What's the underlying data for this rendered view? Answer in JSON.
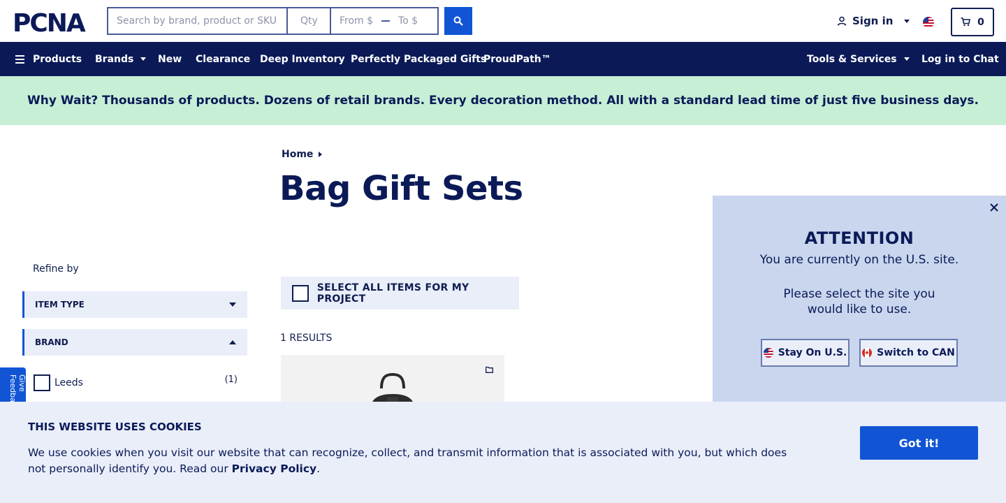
{
  "header": {
    "logo_text": "PCNA",
    "search_placeholder": "Search by brand, product or SKU",
    "qty_placeholder": "Qty",
    "price_from_placeholder": "From $",
    "price_to_placeholder": "To $",
    "signin_label": "Sign in",
    "cart_count": "0"
  },
  "nav": {
    "items": [
      {
        "label": "Products"
      },
      {
        "label": "Brands"
      },
      {
        "label": "New"
      },
      {
        "label": "Clearance"
      },
      {
        "label": "Deep Inventory"
      },
      {
        "label": "Perfectly Packaged Gifts"
      },
      {
        "label": "ProudPath™"
      }
    ],
    "tools_label": "Tools & Services",
    "chat_label": "Log in to Chat"
  },
  "promo": {
    "text": "Why Wait? Thousands of products. Dozens of retail brands. Every decoration method. All with a standard lead time of just five business days."
  },
  "breadcrumb": {
    "home": "Home"
  },
  "page": {
    "title": "Bag Gift Sets"
  },
  "refine": {
    "label": "Refine by",
    "facets": [
      {
        "label": "ITEM TYPE",
        "state": "collapsed"
      },
      {
        "label": "BRAND",
        "state": "expanded"
      }
    ],
    "brand_options": [
      {
        "label": "Leeds",
        "count": "(1)"
      }
    ]
  },
  "feedback": {
    "label": "Give Feedback"
  },
  "results": {
    "select_all_label": "SELECT ALL ITEMS FOR MY PROJECT",
    "count_label": "1 RESULTS"
  },
  "attention": {
    "title": "ATTENTION",
    "line1": "You are currently on the U.S. site.",
    "line2": "Please select the site you",
    "line3": "would like to use.",
    "stay_label": "Stay On U.S.",
    "switch_label": "Switch to CAN"
  },
  "cookie": {
    "title": "THIS WEBSITE USES COOKIES",
    "text": "We use cookies when you visit our website that can recognize, collect, and transmit information that is associated with you, but which does not personally identify you. Read our ",
    "link": "Privacy Policy",
    "end": ".",
    "button": "Got it!"
  },
  "colors": {
    "navy": "#0b1a57",
    "brand_blue": "#1155d4",
    "promo_green": "#c6efd6",
    "panel_blue": "#c9d6ee",
    "light_blue": "#e9eef9"
  }
}
